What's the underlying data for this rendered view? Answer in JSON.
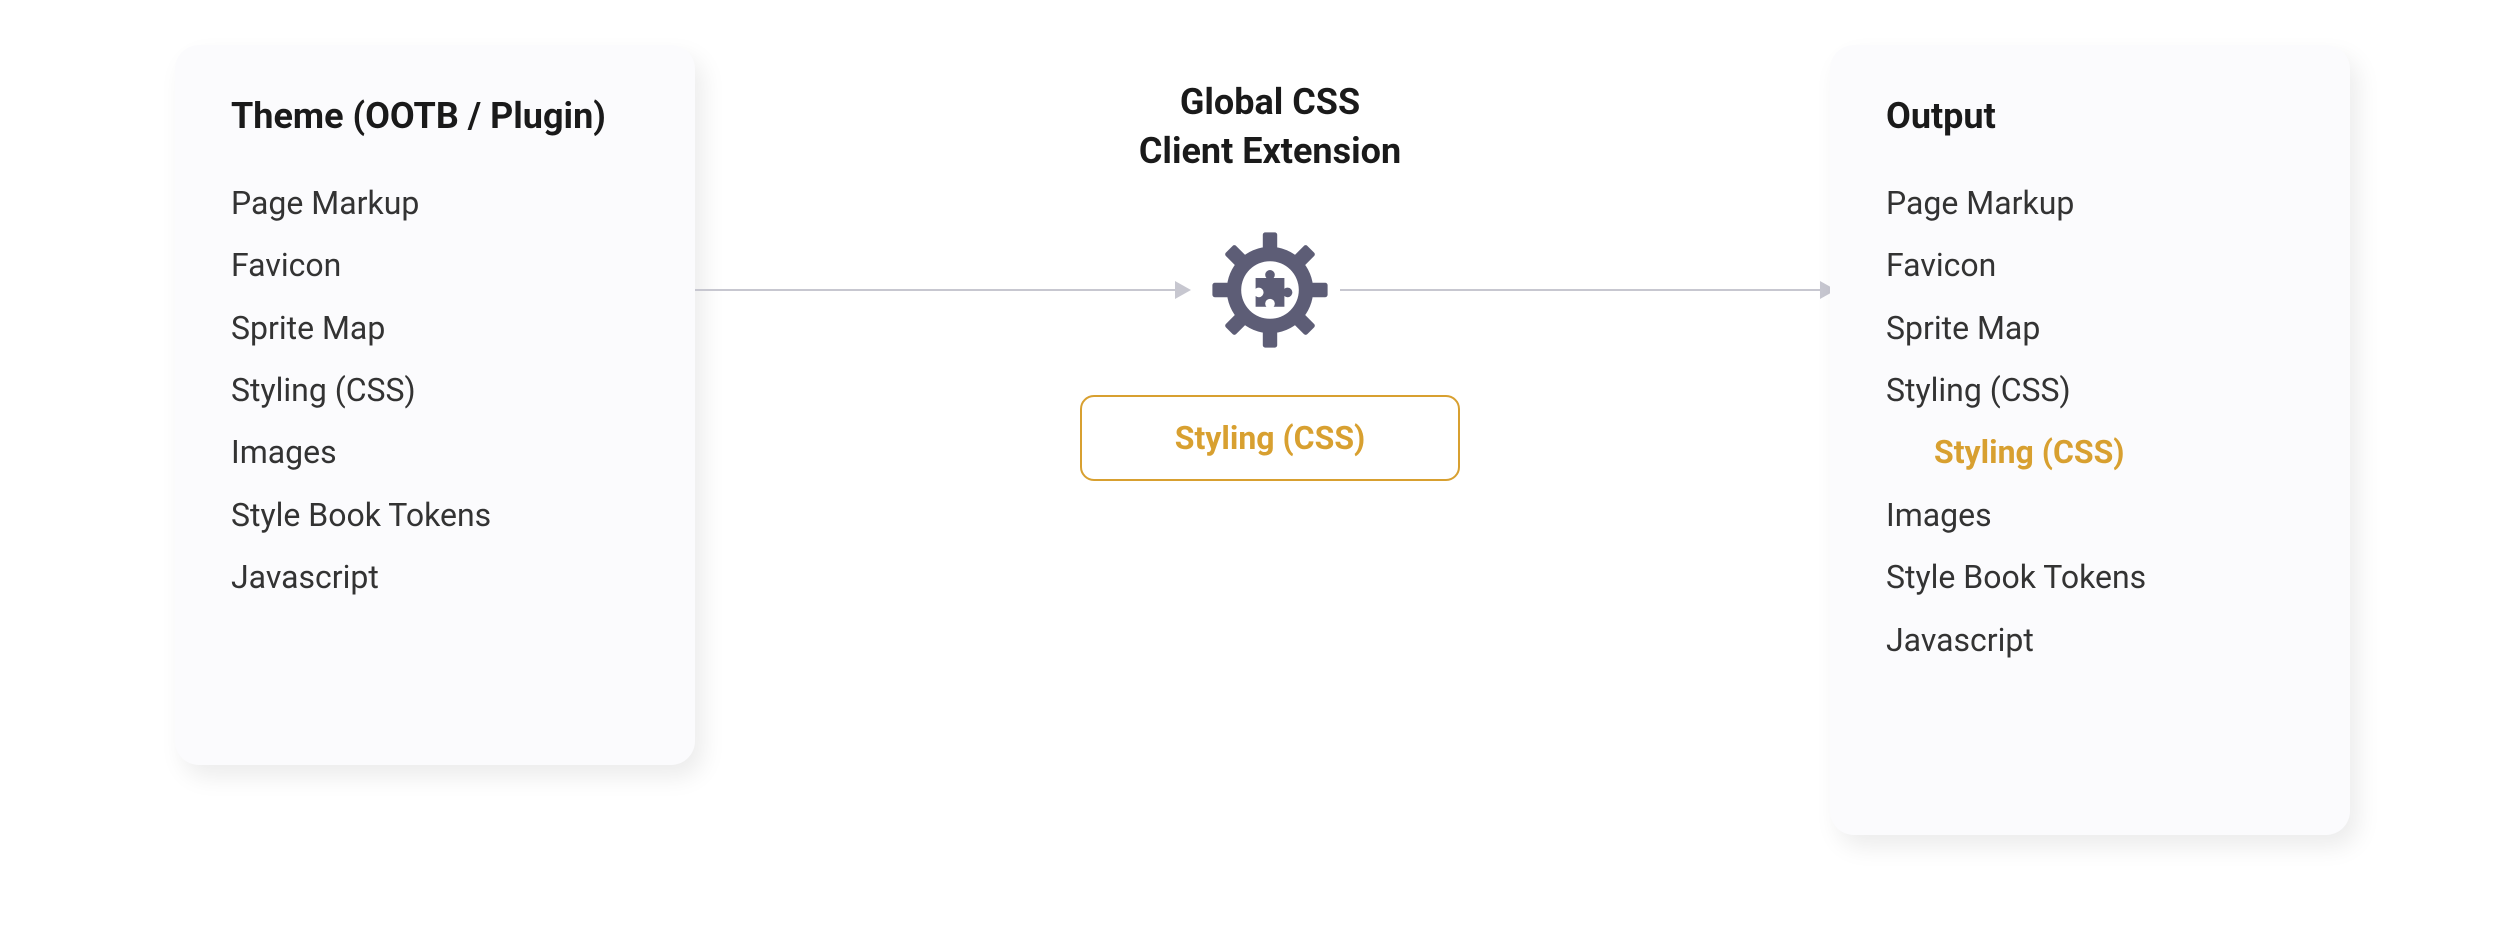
{
  "colors": {
    "accent": "#d8a030",
    "gear": "#5d5d76",
    "card_bg": "#fbfbfd",
    "text": "#1a1a1a",
    "text_item": "#333333",
    "arrow": "#c7c7d0"
  },
  "left_card": {
    "title": "Theme (OOTB / Plugin)",
    "items": [
      {
        "label": "Page Markup",
        "highlighted": false
      },
      {
        "label": "Favicon",
        "highlighted": false
      },
      {
        "label": "Sprite Map",
        "highlighted": false
      },
      {
        "label": "Styling (CSS)",
        "highlighted": false
      },
      {
        "label": "Images",
        "highlighted": false
      },
      {
        "label": "Style Book Tokens",
        "highlighted": false
      },
      {
        "label": "Javascript",
        "highlighted": false
      }
    ]
  },
  "center": {
    "title_line1": "Global CSS",
    "title_line2": "Client Extension",
    "icon": "gear-puzzle",
    "badge_label": "Styling (CSS)"
  },
  "right_card": {
    "title": "Output",
    "items": [
      {
        "label": "Page Markup",
        "highlighted": false
      },
      {
        "label": "Favicon",
        "highlighted": false
      },
      {
        "label": "Sprite Map",
        "highlighted": false
      },
      {
        "label": "Styling (CSS)",
        "highlighted": false
      },
      {
        "label": "Styling (CSS)",
        "highlighted": true
      },
      {
        "label": "Images",
        "highlighted": false
      },
      {
        "label": "Style Book Tokens",
        "highlighted": false
      },
      {
        "label": "Javascript",
        "highlighted": false
      }
    ]
  }
}
